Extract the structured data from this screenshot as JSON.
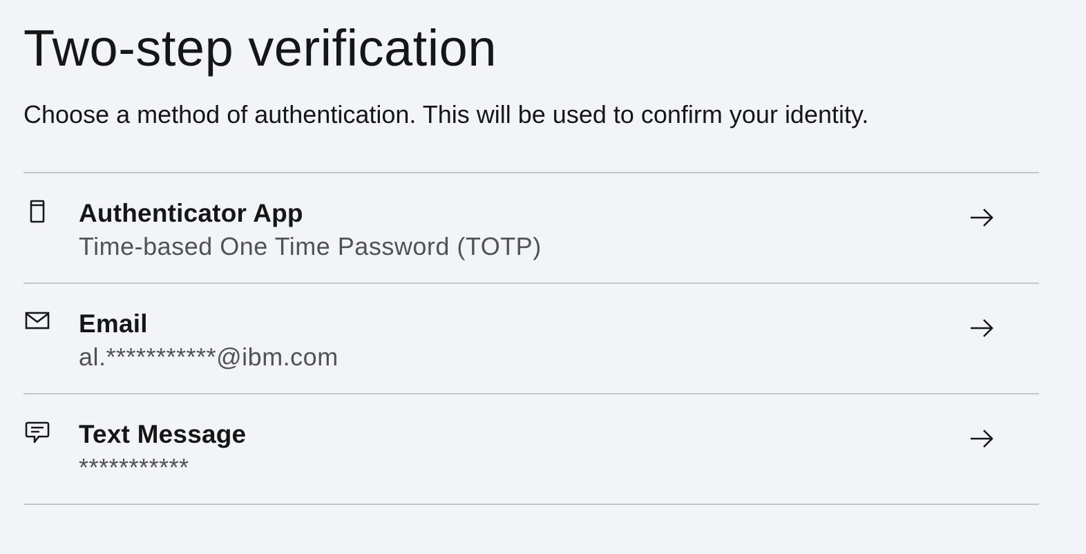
{
  "page": {
    "title": "Two-step verification",
    "subtitle": "Choose a method of authentication. This will be used to confirm your identity."
  },
  "methods": [
    {
      "label": "Authenticator App",
      "detail": "Time-based One Time Password (TOTP)",
      "icon": "mobile-device-icon"
    },
    {
      "label": "Email",
      "detail": "al.***********@ibm.com",
      "icon": "envelope-icon"
    },
    {
      "label": "Text Message",
      "detail": "***********",
      "icon": "chat-message-icon"
    }
  ],
  "colors": {
    "background": "#f2f4f8",
    "text_primary": "#161616",
    "text_secondary": "#525252",
    "divider": "#c6c6c6"
  }
}
